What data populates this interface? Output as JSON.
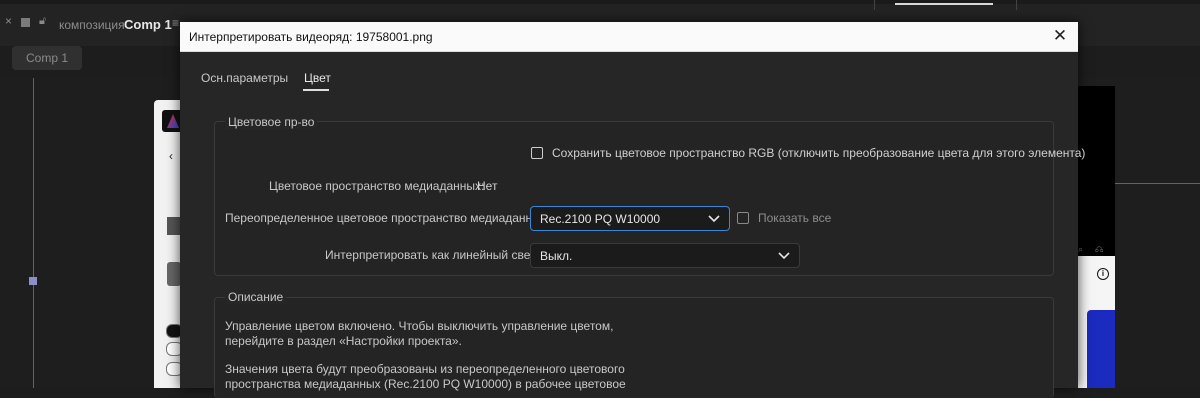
{
  "background": {
    "tab_prefix": "композиция",
    "tab_name": "Comp 1",
    "comp_pill": "Comp 1"
  },
  "dialog": {
    "title": "Интерпретировать видеоряд: 19758001.png",
    "tabs": [
      "Осн.параметры",
      "Цвет"
    ],
    "active_tab": "Цвет",
    "color_space": {
      "title": "Цветовое пр-во",
      "preserve_rgb_label": "Сохранить цветовое пространство RGB (отключить преобразование цвета для этого элемента)",
      "preserve_rgb_checked": false,
      "media_cs_label": "Цветовое пространство медиаданных:",
      "media_cs_value": "Нет",
      "override_label": "Переопределенное цветовое пространство медиаданных:",
      "override_value": "Rec.2100 PQ W10000",
      "show_all_label": "Показать все",
      "show_all_checked": false,
      "linear_label": "Интерпретировать как линейный свет:",
      "linear_value": "Выкл."
    },
    "description": {
      "title": "Описание",
      "line1": "Управление цветом включено. Чтобы выключить управление цветом,",
      "line2": "перейдите в раздел «Настройки проекта».",
      "line3": "Значения цвета будут преобразованы из переопределенного цветового",
      "line4": "пространства медиаданных (Rec.2100 PQ W10000) в рабочее цветовое"
    }
  },
  "colors": {
    "accent": "#3c86d6",
    "dialog_bg": "#262626",
    "titlebar_bg": "#fafafa"
  }
}
